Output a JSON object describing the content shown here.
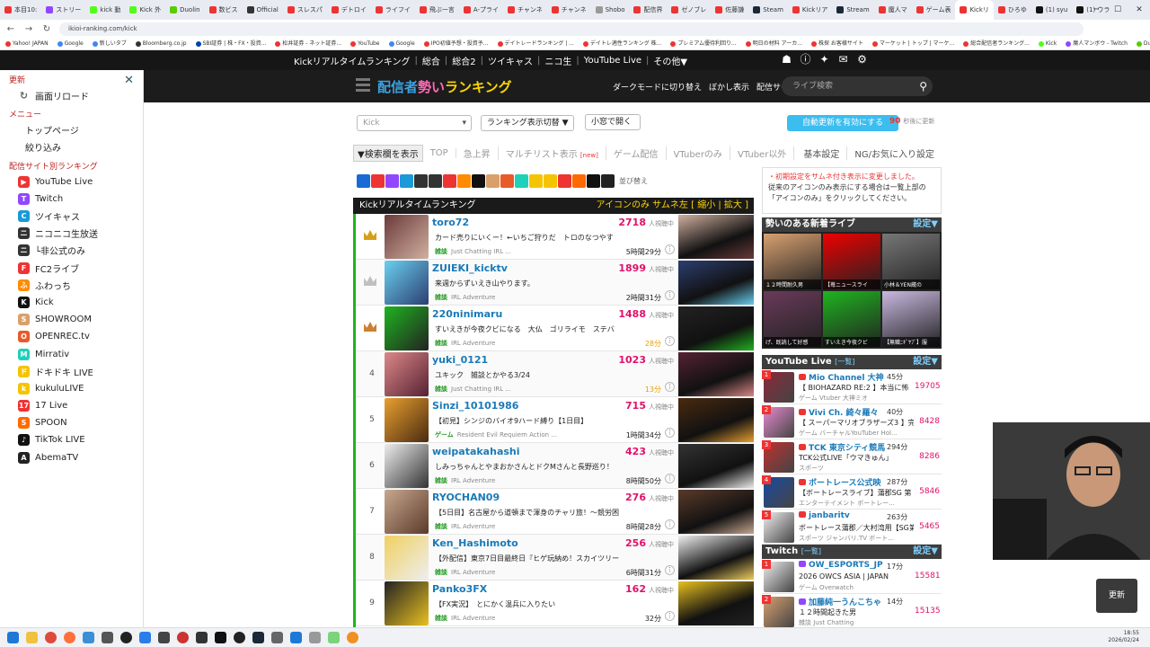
{
  "browser": {
    "tabs": [
      {
        "label": "本目10:",
        "color": "#e33"
      },
      {
        "label": "ストリー",
        "color": "#9146ff"
      },
      {
        "label": "kick 動",
        "color": "#53fc18"
      },
      {
        "label": "Kick 外",
        "color": "#53fc18"
      },
      {
        "label": "Duolin",
        "color": "#58cc02"
      },
      {
        "label": "数ビス",
        "color": "#e33"
      },
      {
        "label": "Official",
        "color": "#333"
      },
      {
        "label": "スレスパ",
        "color": "#e33"
      },
      {
        "label": "デトロイ",
        "color": "#e33"
      },
      {
        "label": "ライフイ",
        "color": "#e33"
      },
      {
        "label": "飛ぶ一言",
        "color": "#e33"
      },
      {
        "label": "A-プライ",
        "color": "#e33"
      },
      {
        "label": "チャンネ",
        "color": "#e33"
      },
      {
        "label": "チャンネ",
        "color": "#e33"
      },
      {
        "label": "Shobo",
        "color": "#999"
      },
      {
        "label": "配信界",
        "color": "#e33"
      },
      {
        "label": "ゼノブレ",
        "color": "#e33"
      },
      {
        "label": "佐藤謙",
        "color": "#e33"
      },
      {
        "label": "Steam",
        "color": "#1b2838"
      },
      {
        "label": "Kickリア",
        "color": "#e33"
      },
      {
        "label": "Stream",
        "color": "#1b2838"
      },
      {
        "label": "魔人マ",
        "color": "#e33"
      },
      {
        "label": "ゲーム表",
        "color": "#e33"
      },
      {
        "label": "Kickリ",
        "color": "#e33"
      },
      {
        "label": "ひろゆ",
        "color": "#e33"
      },
      {
        "label": "(1) syu",
        "color": "#111"
      },
      {
        "label": "(1) ウラ",
        "color": "#111"
      }
    ],
    "active_tab": 23,
    "url": "ikioi-ranking.com/kick",
    "bookmarks": [
      {
        "label": "Yahoo! JAPAN",
        "color": "#e33"
      },
      {
        "label": "Google",
        "color": "#4285f4"
      },
      {
        "label": "新しいタブ",
        "color": "#4285f4"
      },
      {
        "label": "Bloomberg.co.jp",
        "color": "#333"
      },
      {
        "label": "SBI証券 | 株・FX・投資...",
        "color": "#04a"
      },
      {
        "label": "松井証券 - ネット証券...",
        "color": "#e33"
      },
      {
        "label": "YouTube",
        "color": "#e33"
      },
      {
        "label": "Google",
        "color": "#4285f4"
      },
      {
        "label": "IPO初値予想・投資予...",
        "color": "#e33"
      },
      {
        "label": "デイトレードランキング | ...",
        "color": "#e33"
      },
      {
        "label": "デイトレ適性ランキング 株...",
        "color": "#e33"
      },
      {
        "label": "プレミアム優待利回り...",
        "color": "#e33"
      },
      {
        "label": "明日の材料 アーカ...",
        "color": "#e33"
      },
      {
        "label": "株探 お客様サイト",
        "color": "#e33"
      },
      {
        "label": "マーケット | トップ | マーケ...",
        "color": "#e33"
      },
      {
        "label": "総合配信者ランキング...",
        "color": "#e33"
      },
      {
        "label": "Kick",
        "color": "#53fc18"
      },
      {
        "label": "魔人マンボウ - Twitch",
        "color": "#9146ff"
      },
      {
        "label": "Duolingo - 学習为楽しく...",
        "color": "#58cc02"
      }
    ]
  },
  "sitenav": {
    "links": [
      "Kickリアルタイムランキング",
      "総合",
      "総合2",
      "ツイキャス",
      "ニコ生",
      "YouTube Live",
      "その他▼"
    ]
  },
  "sidebar": {
    "section_update": "更新",
    "reload": "画面リロード",
    "section_menu": "メニュー",
    "top_page": "トップページ",
    "filter": "絞り込み",
    "section_sites": "配信サイト別ランキング",
    "items": [
      {
        "label": "YouTube Live",
        "icon": "youtube-icon",
        "color": "#e33",
        "glyph": "▶"
      },
      {
        "label": "Twitch",
        "icon": "twitch-icon",
        "color": "#9146ff",
        "glyph": "T"
      },
      {
        "label": "ツイキャス",
        "icon": "twitcasting-icon",
        "color": "#1a9ad6",
        "glyph": "C"
      },
      {
        "label": "ニコニコ生放送",
        "icon": "niconico-icon",
        "color": "#333",
        "glyph": "ニ"
      },
      {
        "label": "└非公式のみ",
        "icon": "niconico-icon",
        "color": "#333",
        "glyph": "ニ"
      },
      {
        "label": "FC2ライブ",
        "icon": "fc2-icon",
        "color": "#e33",
        "glyph": "F"
      },
      {
        "label": "ふわっち",
        "icon": "fuwacchi-icon",
        "color": "#ff8c00",
        "glyph": "ふ"
      },
      {
        "label": "Kick",
        "icon": "kick-icon",
        "color": "#111",
        "glyph": "K"
      },
      {
        "label": "SHOWROOM",
        "icon": "showroom-icon",
        "color": "#d9a06b",
        "glyph": "S"
      },
      {
        "label": "OPENREC.tv",
        "icon": "openrec-icon",
        "color": "#e85a2a",
        "glyph": "O"
      },
      {
        "label": "Mirrativ",
        "icon": "mirrativ-icon",
        "color": "#1fd1b8",
        "glyph": "M"
      },
      {
        "label": "ドキドキ LIVE",
        "icon": "dokidoki-icon",
        "color": "#f5c400",
        "glyph": "ド"
      },
      {
        "label": "kukuluLIVE",
        "icon": "kukulu-icon",
        "color": "#f5c400",
        "glyph": "k"
      },
      {
        "label": "17 Live",
        "icon": "17live-icon",
        "color": "#e33",
        "glyph": "17"
      },
      {
        "label": "SPOON",
        "icon": "spoon-icon",
        "color": "#ff6a00",
        "glyph": "S"
      },
      {
        "label": "TikTok LIVE",
        "icon": "tiktok-icon",
        "color": "#111",
        "glyph": "♪"
      },
      {
        "label": "AbemaTV",
        "icon": "abema-icon",
        "color": "#222",
        "glyph": "A"
      }
    ]
  },
  "header": {
    "logo_a": "配信者",
    "logo_b": "勢い",
    "logo_c": "ランキング",
    "dark_mode": "ダークモードに切り替え",
    "blur": "ぼかし表示",
    "site_select": "配信サイト▼",
    "search_placeholder": "ライブ検索"
  },
  "controls": {
    "site_select": "Kick",
    "rank_toggle": "ランキング表示切替 ▼",
    "open_small": "小窓で開く",
    "auto_refresh": "自動更新を有効にする",
    "refresh_seconds": "90",
    "refresh_label": "秒後に更新"
  },
  "filters": [
    "▼検索欄を表示",
    "TOP",
    "急上昇",
    "マルチリスト表示",
    "ゲーム配信",
    "VTuberのみ",
    "VTuber以外",
    "基本設定",
    "NG/お気に入り設定"
  ],
  "filter_new": "[new]",
  "sort_label": "並び替え",
  "ranking": {
    "title": "Kickリアルタイムランキング",
    "options": "アイコンのみ サムネ左 [ 縮小 | 拡大 ]",
    "viewer_label": "人視聴中",
    "rows": [
      {
        "rank": "1",
        "name": "toro72",
        "viewers": "2718",
        "title": "カード売りにいくー！←いちご狩りだ　トロのなつやす",
        "cat": "雑談",
        "tags": "Just Chatting  IRL ...",
        "dur": "5時間29分",
        "hot": false,
        "c1": "#6b3a3a",
        "c2": "#d0b0a0"
      },
      {
        "rank": "2",
        "name": "ZUIEKI_kicktv",
        "viewers": "1899",
        "title": "来週からずいえき山やります。",
        "cat": "雑談",
        "tags": "IRL  Adventure",
        "dur": "2時間31分",
        "hot": false,
        "c1": "#6ad0f0",
        "c2": "#2c3e70"
      },
      {
        "rank": "3",
        "name": "220ninimaru",
        "viewers": "1488",
        "title": "すいえきが今夜クビになる　大仏　ゴリライモ　ステバ",
        "cat": "雑談",
        "tags": "IRL  Adventure",
        "dur": "28分",
        "hot": true,
        "c1": "#1fb41f",
        "c2": "#222"
      },
      {
        "rank": "4",
        "name": "yuki_0121",
        "viewers": "1023",
        "title": "ユキック　雑談とかやる3/24",
        "cat": "雑談",
        "tags": "Just Chatting  IRL ...",
        "dur": "13分",
        "hot": true,
        "c1": "#d88",
        "c2": "#523"
      },
      {
        "rank": "5",
        "name": "Sinzi_10101986",
        "viewers": "715",
        "title": "【初見】シンジのバイオ9ハード縛り【1日目】",
        "cat": "ゲーム",
        "tags": "Resident Evil Requiem  Action ...",
        "dur": "1時間34分",
        "hot": false,
        "c1": "#e8a030",
        "c2": "#4a2a10"
      },
      {
        "rank": "6",
        "name": "weipatakahashi",
        "viewers": "423",
        "title": "しみっちゃんとやまおかさんとドクMさんと長野巡り！",
        "cat": "雑談",
        "tags": "IRL  Adventure",
        "dur": "8時間50分",
        "hot": false,
        "c1": "#eee",
        "c2": "#333"
      },
      {
        "rank": "7",
        "name": "RYOCHAN09",
        "viewers": "276",
        "title": "【5日目】名古屋から道頓まで渾身のチャリ旅！〜競労困",
        "cat": "雑談",
        "tags": "IRL  Adventure",
        "dur": "8時間28分",
        "hot": false,
        "c1": "#c9a890",
        "c2": "#5a3a2a"
      },
      {
        "rank": "8",
        "name": "Ken_Hashimoto",
        "viewers": "256",
        "title": "【外配信】東京7日目最終日『ヒゲ玩納め！スカイツリー",
        "cat": "雑談",
        "tags": "IRL  Adventure",
        "dur": "6時間31分",
        "hot": false,
        "c1": "#f0d060",
        "c2": "#eee"
      },
      {
        "rank": "9",
        "name": "Panko3FX",
        "viewers": "162",
        "title": "【FX実況】　とにかく温兵に入りたい",
        "cat": "雑談",
        "tags": "IRL  Adventure",
        "dur": "32分",
        "hot": false,
        "c1": "#222",
        "c2": "#e8c020"
      }
    ]
  },
  "notice": {
    "line1": "・初期設定をサムネ付き表示に変更しました。",
    "line2": "従来のアイコンのみ表示にする場合は一覧上部の「アイコンのみ」をクリックしてください。"
  },
  "new_live": {
    "title": "勢いのある新着ライブ",
    "settings": "設定▼",
    "items": [
      {
        "cap": "１２時間耐久男",
        "c": "#d8a070"
      },
      {
        "cap": "【苺ニュースライ",
        "c": "#e00"
      },
      {
        "cap": "小林＆YEN蔵の",
        "c": "#777"
      },
      {
        "cap": "げ、既読して好感",
        "c": "#6a3a5a"
      },
      {
        "cap": "すいえき今夜クビ",
        "c": "#1fb41f"
      },
      {
        "cap": "【無職ﾆｷﾞﾔﾌﾞ】服",
        "c": "#c9b8e0"
      }
    ]
  },
  "youtube": {
    "title": "YouTube Live",
    "all": "[一覧]",
    "settings": "設定▼",
    "rows": [
      {
        "rank": "1",
        "name": "Mio Channel 大神",
        "mins": "45分",
        "title": "【 BIOHAZARD RE:2 】本当に怖",
        "tags": "ゲーム  Vtuber  大神ミオ",
        "viewers": "19705",
        "c": "#8a2a3a"
      },
      {
        "rank": "2",
        "name": "Vivi Ch. 綺々羅々",
        "mins": "40分",
        "title": "【 スーパーマリオブラザーズ3 】完",
        "tags": "ゲーム  バーチャルYouTuber  Hol...",
        "viewers": "8428",
        "c": "#e88ad0"
      },
      {
        "rank": "3",
        "name": "TCK 東京シティ競馬",
        "mins": "294分",
        "title": "TCK公式LIVE「ウマきゅん」",
        "tags": "スポーツ",
        "viewers": "8286",
        "c": "#c03030"
      },
      {
        "rank": "4",
        "name": "ボートレース公式映",
        "mins": "287分",
        "title": "【ボートレースライブ】蒲郡SG 第",
        "tags": "エンターテイメント  ボートレー...",
        "viewers": "5846",
        "c": "#1a4aa0"
      },
      {
        "rank": "5",
        "name": "janbaritv",
        "mins": "263分",
        "title": "ボートレース蒲郡／大村湾用【SG第",
        "tags": "スポーツ  ジャンバリ.TV  ボート...",
        "viewers": "5465",
        "c": "#f0f0f0"
      }
    ]
  },
  "twitch": {
    "title": "Twitch",
    "all": "[一覧]",
    "settings": "設定▼",
    "rows": [
      {
        "rank": "1",
        "name": "OW_ESPORTS_JP",
        "mins": "17分",
        "title": "2026 OWCS ASIA | JAPAN",
        "tags": "ゲーム  Overwatch",
        "viewers": "15581",
        "c": "#eee"
      },
      {
        "rank": "2",
        "name": "加藤純一うんこちゃ",
        "mins": "14分",
        "title": "１２時間起きた男",
        "tags": "雑談  Just Chatting",
        "viewers": "15135",
        "c": "#d8a070"
      }
    ]
  },
  "float_button": "更新",
  "clock": {
    "time": "18:55",
    "date": "2026/02/24"
  }
}
